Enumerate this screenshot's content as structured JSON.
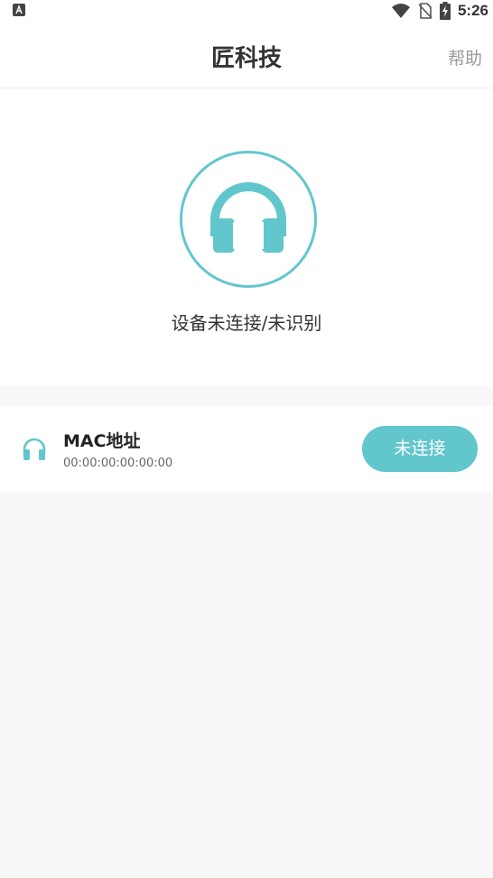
{
  "status_bar": {
    "time": "5:26",
    "icons": [
      "accessibility-icon",
      "wifi-icon",
      "no-sim-icon",
      "battery-charging-icon"
    ]
  },
  "app_bar": {
    "title": "匠科技",
    "help_label": "帮助"
  },
  "device_status": {
    "icon": "headphones-icon",
    "text": "设备未连接/未识别"
  },
  "device_row": {
    "icon": "headphones-icon",
    "mac_label": "MAC地址",
    "mac_value": "00:00:00:00:00:00",
    "connect_label": "未连接"
  },
  "colors": {
    "accent": "#62c6cd",
    "background": "#f8f8f8",
    "surface": "#ffffff"
  }
}
